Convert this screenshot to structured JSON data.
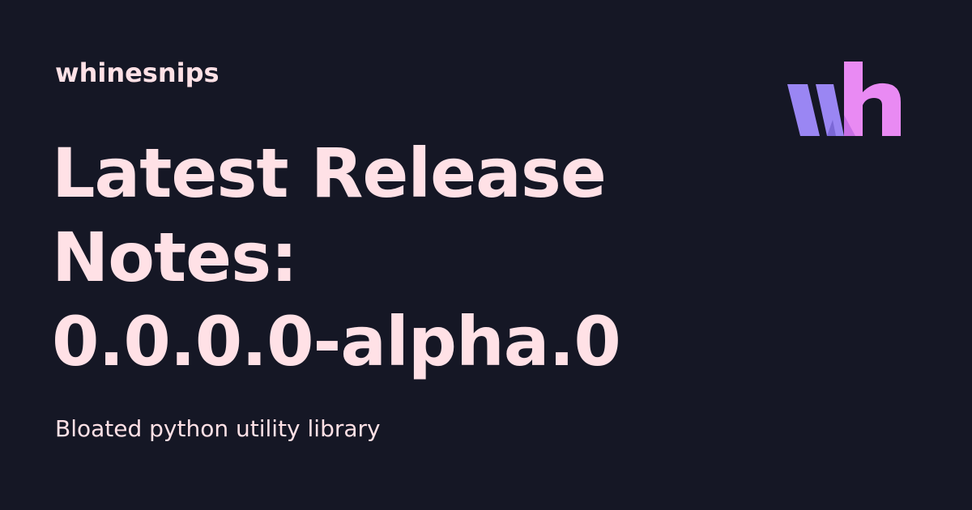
{
  "header": {
    "site_name": "whinesnips"
  },
  "main": {
    "title_lines": [
      "Latest Release",
      "Notes:",
      "0.0.0.0-alpha.0"
    ],
    "tagline": "Bloated python utility library"
  },
  "logo": {
    "icon": "wh-monogram-icon",
    "colors": {
      "w_primary": "#9a86f3",
      "h_primary": "#e98af3",
      "w_shadow": "#7b68d6",
      "h_shadow": "#c86fe5"
    }
  },
  "theme": {
    "background": "#151725",
    "text": "#ffe1e6"
  }
}
